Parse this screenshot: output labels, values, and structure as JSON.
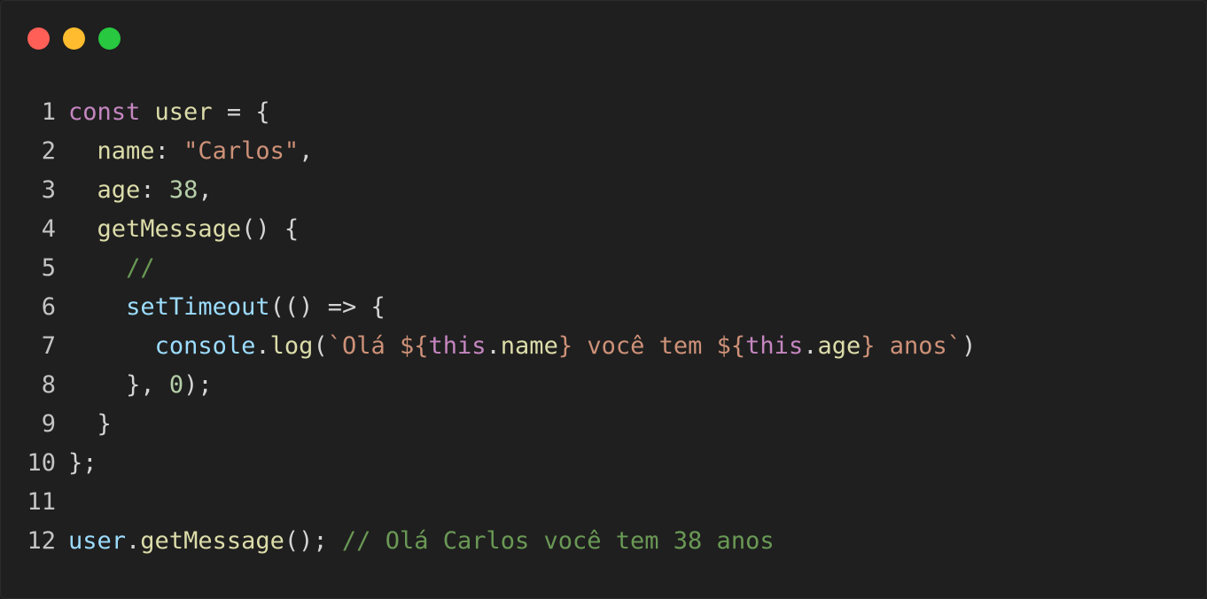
{
  "window": {
    "controls": [
      "close",
      "minimize",
      "maximize"
    ],
    "colors": {
      "close": "#ff5f57",
      "minimize": "#febc2e",
      "maximize": "#28c840"
    }
  },
  "code": {
    "language": "javascript",
    "lines": [
      {
        "n": "1",
        "text": "const user = {"
      },
      {
        "n": "2",
        "text": "  name: \"Carlos\","
      },
      {
        "n": "3",
        "text": "  age: 38,"
      },
      {
        "n": "4",
        "text": "  getMessage() {"
      },
      {
        "n": "5",
        "text": "    //"
      },
      {
        "n": "6",
        "text": "    setTimeout(() => {"
      },
      {
        "n": "7",
        "text": "      console.log(`Olá ${this.name} você tem ${this.age} anos`)"
      },
      {
        "n": "8",
        "text": "    }, 0);"
      },
      {
        "n": "9",
        "text": "  }"
      },
      {
        "n": "10",
        "text": "};"
      },
      {
        "n": "11",
        "text": ""
      },
      {
        "n": "12",
        "text": "user.getMessage(); // Olá Carlos você tem 38 anos"
      }
    ]
  }
}
